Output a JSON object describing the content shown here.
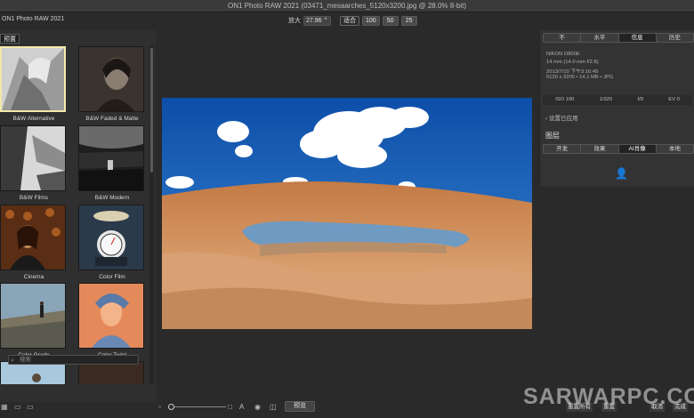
{
  "window": {
    "title": "ON1 Photo RAW 2021 (03471_mesaarches_5120x3200.jpg @ 28.0% 8-bit)",
    "app_name": "ON1 Photo RAW 2021"
  },
  "zoom": {
    "label": "放大",
    "value": "27.96",
    "buttons": [
      "适合",
      "100",
      "50",
      "25"
    ],
    "active": "适合"
  },
  "presets": {
    "tab": "预置",
    "items": [
      {
        "label": "B&W Alternative",
        "selected": true
      },
      {
        "label": "B&W Faded & Matte"
      },
      {
        "label": "B&W Films"
      },
      {
        "label": "B&W Modern"
      },
      {
        "label": "Cinema"
      },
      {
        "label": "Color Film"
      },
      {
        "label": "Color Grade"
      },
      {
        "label": "Color Twist"
      }
    ],
    "search_placeholder": "搜索"
  },
  "right_panel": {
    "tabs": [
      "不",
      "水平",
      "信息",
      "历史"
    ],
    "active_tab": "信息",
    "info": {
      "camera": "NIKON D800E",
      "lens": "14 mm (14.0 mm f/2.8)",
      "date": "2013/7/10 下午3:16:49",
      "size": "5120 x 3200 • 14.1 MB • JPG",
      "exif": [
        "ISO 100",
        "1/320",
        "f/9",
        "EV 0"
      ]
    },
    "applied_settings": "设置已应用",
    "layers_title": "图层",
    "layer_tabs": [
      "开发",
      "效果",
      "AI肖像",
      "本地"
    ],
    "active_layer_tab": "AI肖像"
  },
  "bottom": {
    "preview": "预览",
    "buttons": [
      "重置所有",
      "重置",
      "取消",
      "完成"
    ]
  },
  "watermark": "SARWARPC.CO",
  "colors": {
    "accent_selected": "#f2e8a8",
    "sky": "#1f5fb4",
    "rock": "#d79a63"
  }
}
